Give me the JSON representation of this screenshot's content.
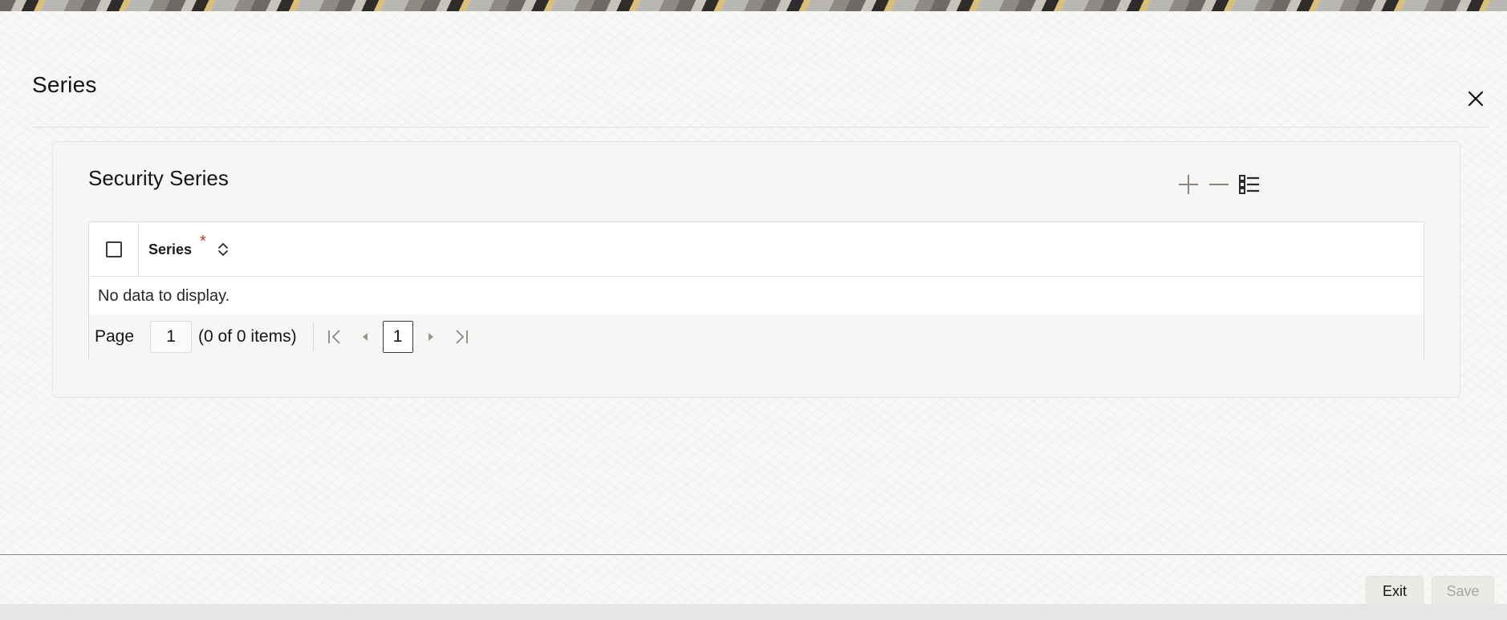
{
  "dialog": {
    "title": "Series",
    "close_icon": "close-icon"
  },
  "panel": {
    "title": "Security Series",
    "toolbar": {
      "add_icon": "plus-icon",
      "remove_icon": "minus-icon",
      "view_icon": "list-view-icon"
    }
  },
  "grid": {
    "columns": [
      {
        "label": "Series",
        "required_marker": "*"
      }
    ],
    "empty_message": "No data to display."
  },
  "pagination": {
    "label": "Page",
    "current_page_input": "1",
    "items_summary": "(0 of 0 items)",
    "page_number": "1"
  },
  "footer": {
    "exit_label": "Exit",
    "save_label": "Save"
  },
  "colors": {
    "required": "#c2342e",
    "disabled_text": "#a9a6a2"
  }
}
